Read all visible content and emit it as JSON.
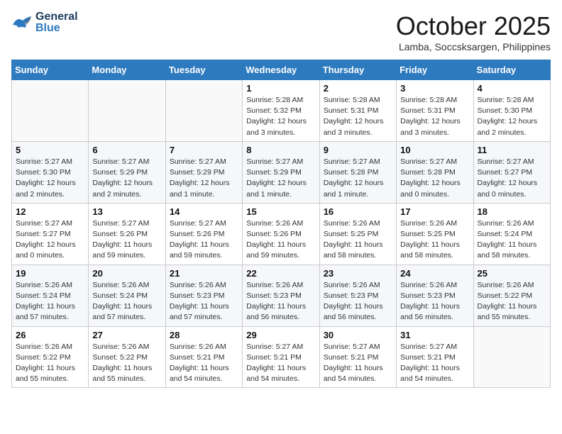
{
  "logo": {
    "general": "General",
    "blue": "Blue"
  },
  "header": {
    "month_year": "October 2025",
    "location": "Lamba, Soccsksargen, Philippines"
  },
  "weekdays": [
    "Sunday",
    "Monday",
    "Tuesday",
    "Wednesday",
    "Thursday",
    "Friday",
    "Saturday"
  ],
  "weeks": [
    [
      {
        "day": "",
        "info": ""
      },
      {
        "day": "",
        "info": ""
      },
      {
        "day": "",
        "info": ""
      },
      {
        "day": "1",
        "info": "Sunrise: 5:28 AM\nSunset: 5:32 PM\nDaylight: 12 hours\nand 3 minutes."
      },
      {
        "day": "2",
        "info": "Sunrise: 5:28 AM\nSunset: 5:31 PM\nDaylight: 12 hours\nand 3 minutes."
      },
      {
        "day": "3",
        "info": "Sunrise: 5:28 AM\nSunset: 5:31 PM\nDaylight: 12 hours\nand 3 minutes."
      },
      {
        "day": "4",
        "info": "Sunrise: 5:28 AM\nSunset: 5:30 PM\nDaylight: 12 hours\nand 2 minutes."
      }
    ],
    [
      {
        "day": "5",
        "info": "Sunrise: 5:27 AM\nSunset: 5:30 PM\nDaylight: 12 hours\nand 2 minutes."
      },
      {
        "day": "6",
        "info": "Sunrise: 5:27 AM\nSunset: 5:29 PM\nDaylight: 12 hours\nand 2 minutes."
      },
      {
        "day": "7",
        "info": "Sunrise: 5:27 AM\nSunset: 5:29 PM\nDaylight: 12 hours\nand 1 minute."
      },
      {
        "day": "8",
        "info": "Sunrise: 5:27 AM\nSunset: 5:29 PM\nDaylight: 12 hours\nand 1 minute."
      },
      {
        "day": "9",
        "info": "Sunrise: 5:27 AM\nSunset: 5:28 PM\nDaylight: 12 hours\nand 1 minute."
      },
      {
        "day": "10",
        "info": "Sunrise: 5:27 AM\nSunset: 5:28 PM\nDaylight: 12 hours\nand 0 minutes."
      },
      {
        "day": "11",
        "info": "Sunrise: 5:27 AM\nSunset: 5:27 PM\nDaylight: 12 hours\nand 0 minutes."
      }
    ],
    [
      {
        "day": "12",
        "info": "Sunrise: 5:27 AM\nSunset: 5:27 PM\nDaylight: 12 hours\nand 0 minutes."
      },
      {
        "day": "13",
        "info": "Sunrise: 5:27 AM\nSunset: 5:26 PM\nDaylight: 11 hours\nand 59 minutes."
      },
      {
        "day": "14",
        "info": "Sunrise: 5:27 AM\nSunset: 5:26 PM\nDaylight: 11 hours\nand 59 minutes."
      },
      {
        "day": "15",
        "info": "Sunrise: 5:26 AM\nSunset: 5:26 PM\nDaylight: 11 hours\nand 59 minutes."
      },
      {
        "day": "16",
        "info": "Sunrise: 5:26 AM\nSunset: 5:25 PM\nDaylight: 11 hours\nand 58 minutes."
      },
      {
        "day": "17",
        "info": "Sunrise: 5:26 AM\nSunset: 5:25 PM\nDaylight: 11 hours\nand 58 minutes."
      },
      {
        "day": "18",
        "info": "Sunrise: 5:26 AM\nSunset: 5:24 PM\nDaylight: 11 hours\nand 58 minutes."
      }
    ],
    [
      {
        "day": "19",
        "info": "Sunrise: 5:26 AM\nSunset: 5:24 PM\nDaylight: 11 hours\nand 57 minutes."
      },
      {
        "day": "20",
        "info": "Sunrise: 5:26 AM\nSunset: 5:24 PM\nDaylight: 11 hours\nand 57 minutes."
      },
      {
        "day": "21",
        "info": "Sunrise: 5:26 AM\nSunset: 5:23 PM\nDaylight: 11 hours\nand 57 minutes."
      },
      {
        "day": "22",
        "info": "Sunrise: 5:26 AM\nSunset: 5:23 PM\nDaylight: 11 hours\nand 56 minutes."
      },
      {
        "day": "23",
        "info": "Sunrise: 5:26 AM\nSunset: 5:23 PM\nDaylight: 11 hours\nand 56 minutes."
      },
      {
        "day": "24",
        "info": "Sunrise: 5:26 AM\nSunset: 5:23 PM\nDaylight: 11 hours\nand 56 minutes."
      },
      {
        "day": "25",
        "info": "Sunrise: 5:26 AM\nSunset: 5:22 PM\nDaylight: 11 hours\nand 55 minutes."
      }
    ],
    [
      {
        "day": "26",
        "info": "Sunrise: 5:26 AM\nSunset: 5:22 PM\nDaylight: 11 hours\nand 55 minutes."
      },
      {
        "day": "27",
        "info": "Sunrise: 5:26 AM\nSunset: 5:22 PM\nDaylight: 11 hours\nand 55 minutes."
      },
      {
        "day": "28",
        "info": "Sunrise: 5:26 AM\nSunset: 5:21 PM\nDaylight: 11 hours\nand 54 minutes."
      },
      {
        "day": "29",
        "info": "Sunrise: 5:27 AM\nSunset: 5:21 PM\nDaylight: 11 hours\nand 54 minutes."
      },
      {
        "day": "30",
        "info": "Sunrise: 5:27 AM\nSunset: 5:21 PM\nDaylight: 11 hours\nand 54 minutes."
      },
      {
        "day": "31",
        "info": "Sunrise: 5:27 AM\nSunset: 5:21 PM\nDaylight: 11 hours\nand 54 minutes."
      },
      {
        "day": "",
        "info": ""
      }
    ]
  ]
}
